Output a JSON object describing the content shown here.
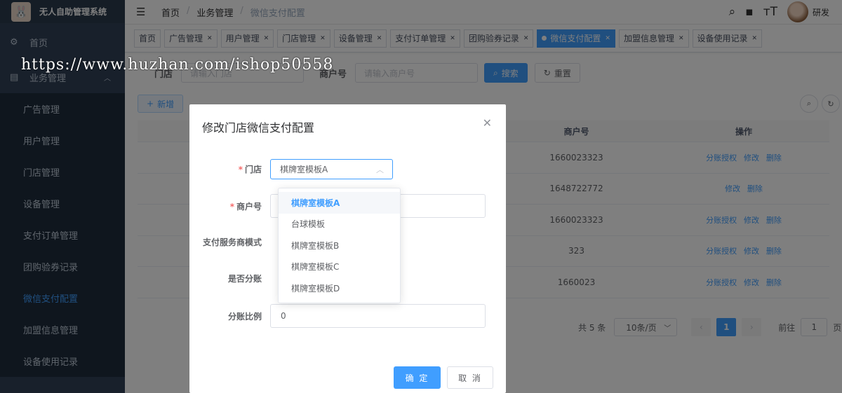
{
  "app": {
    "title": "无人自助管理系统"
  },
  "sidebar": {
    "home": "首页",
    "group": "业务管理",
    "items": [
      {
        "label": "广告管理"
      },
      {
        "label": "用户管理"
      },
      {
        "label": "门店管理"
      },
      {
        "label": "设备管理"
      },
      {
        "label": "支付订单管理"
      },
      {
        "label": "团购验券记录"
      },
      {
        "label": "微信支付配置"
      },
      {
        "label": "加盟信息管理"
      },
      {
        "label": "设备使用记录"
      }
    ]
  },
  "navbar": {
    "breadcrumb": [
      "首页",
      "业务管理",
      "微信支付配置"
    ],
    "user": "研发"
  },
  "tags": [
    "首页",
    "广告管理",
    "用户管理",
    "门店管理",
    "设备管理",
    "支付订单管理",
    "团购验券记录",
    "微信支付配置",
    "加盟信息管理",
    "设备使用记录"
  ],
  "search": {
    "store_label": "门店",
    "store_placeholder": "请输入门店",
    "merchant_label": "商户号",
    "merchant_placeholder": "请输入商户号",
    "search_btn": "搜索",
    "reset_btn": "重置",
    "add_btn": "新增"
  },
  "table": {
    "headers": {
      "merchant": "商户号",
      "ops": "操作"
    },
    "rows": [
      {
        "merchant": "1660023323",
        "ops": [
          "分账授权",
          "修改",
          "删除"
        ]
      },
      {
        "merchant": "1648722772",
        "ops": [
          "修改",
          "删除"
        ]
      },
      {
        "merchant": "1660023323",
        "ops": [
          "分账授权",
          "修改",
          "删除"
        ]
      },
      {
        "merchant": "323",
        "ops": [
          "分账授权",
          "修改",
          "删除"
        ]
      },
      {
        "merchant": "1660023",
        "ops": [
          "分账授权",
          "修改",
          "删除"
        ]
      }
    ]
  },
  "pagination": {
    "total": "共 5 条",
    "page_size": "10条/页",
    "current": "1",
    "goto_prefix": "前往",
    "goto_value": "1",
    "goto_suffix": "页"
  },
  "dialog": {
    "title": "修改门店微信支付配置",
    "store_label": "门店",
    "store_value": "棋牌室模板A",
    "merchant_label": "商户号",
    "mode_label": "支付服务商模式",
    "split_label": "是否分账",
    "ratio_label": "分账比例",
    "ratio_value": "0",
    "ok_btn": "确 定",
    "cancel_btn": "取 消",
    "options": [
      "棋牌室模板A",
      "台球模板",
      "棋牌室模板B",
      "棋牌室模板C",
      "棋牌室模板D"
    ],
    "selected_index": 0
  },
  "watermark": "https://www.huzhan.com/ishop50558",
  "colors": {
    "primary": "#409eff",
    "sidebar": "#304156",
    "danger": "#f56c6c"
  }
}
